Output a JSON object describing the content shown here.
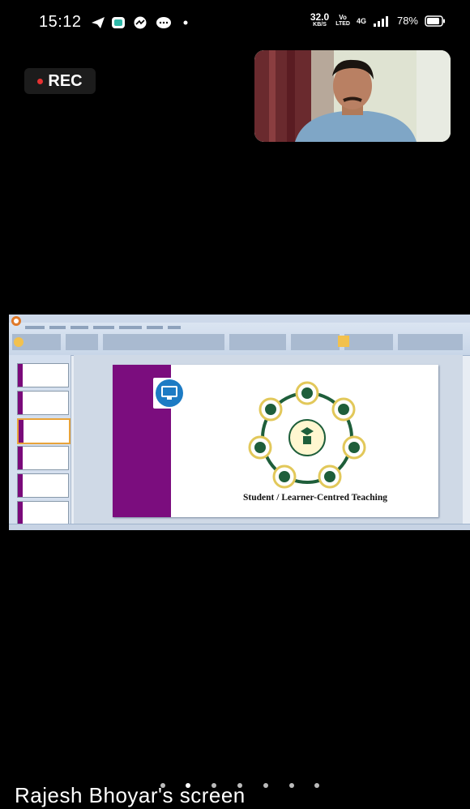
{
  "status_bar": {
    "time": "15:12",
    "speed_value": "32.0",
    "speed_unit": "KB/S",
    "volte_top": "Vo",
    "volte_bottom": "LTED",
    "network_label": "4G",
    "battery_percent": "78%",
    "icons": [
      "telegram-icon",
      "message-app-icon",
      "messenger-icon",
      "chat-icon",
      "notification-dot-icon",
      "signal-icon",
      "battery-icon"
    ]
  },
  "recording": {
    "label": "REC",
    "dot_color": "#e63232"
  },
  "shared_screen": {
    "slide_title": "Student / Learner-Centred Teaching",
    "accent_color": "#7b0d7e",
    "wheel_color": "#1e5e3a"
  },
  "presenter": {
    "screen_label": "Rajesh Bhoyar's screen"
  },
  "pager": {
    "count": 7,
    "active_index": 1
  }
}
